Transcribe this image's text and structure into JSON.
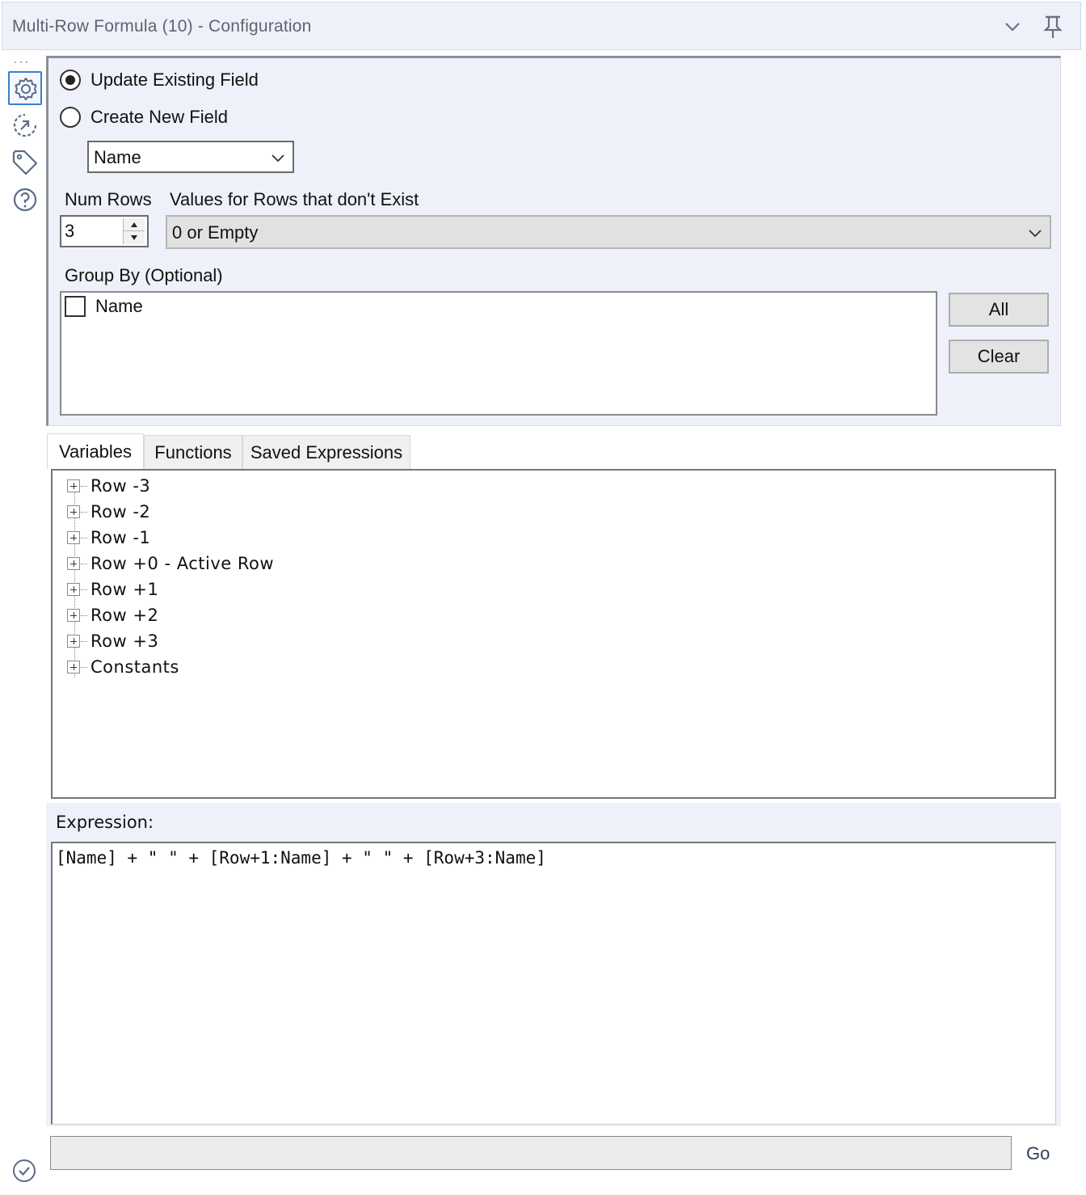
{
  "window": {
    "title": "Multi-Row Formula (10) - Configuration",
    "icons": [
      "chevron-down-icon",
      "pin-icon"
    ]
  },
  "rail": {
    "items": [
      {
        "name": "gear-icon",
        "active": true
      },
      {
        "name": "connection-icon",
        "active": false
      },
      {
        "name": "tag-icon",
        "active": false
      },
      {
        "name": "help-icon",
        "active": false
      }
    ]
  },
  "config": {
    "mode_options": [
      {
        "label": "Update Existing Field",
        "checked": true
      },
      {
        "label": "Create New  Field",
        "checked": false
      }
    ],
    "field_select": {
      "value": "Name"
    },
    "num_rows": {
      "label": "Num Rows",
      "value": "3"
    },
    "values_for_missing": {
      "label": "Values for Rows that don't Exist",
      "value": "0 or Empty"
    },
    "group_by": {
      "label": "Group By (Optional)",
      "items": [
        {
          "label": "Name",
          "checked": false
        }
      ]
    },
    "buttons": {
      "all": "All",
      "clear": "Clear"
    }
  },
  "tabs": [
    {
      "label": "Variables",
      "active": true
    },
    {
      "label": "Functions",
      "active": false
    },
    {
      "label": "Saved Expressions",
      "active": false
    }
  ],
  "variables_tree": [
    "Row -3",
    "Row -2",
    "Row -1",
    "Row +0 - Active Row",
    "Row +1",
    "Row +2",
    "Row +3",
    "Constants"
  ],
  "expression": {
    "label": "Expression:",
    "value": "[Name] + \" \" + [Row+1:Name] + \" \" + [Row+3:Name]"
  },
  "footer": {
    "go_label": "Go",
    "status_value": ""
  },
  "colors": {
    "panel_bg": "#eef1f9",
    "accent": "#3a7fd0",
    "icon": "#5b6d86"
  }
}
